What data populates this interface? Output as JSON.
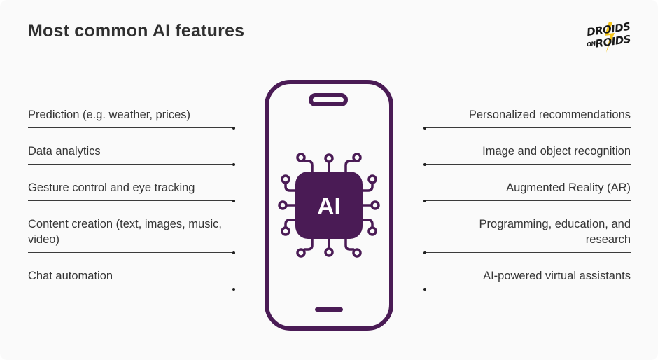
{
  "title": "Most common AI features",
  "logo": {
    "line1": "DROIDS",
    "line2_small": "ON",
    "line2": "ROIDS",
    "bolt_color": "#f5c518"
  },
  "colors": {
    "accent": "#4a1b55",
    "text": "#353535",
    "background": "#fafafa"
  },
  "center_icon": {
    "label": "AI",
    "icon": "smartphone-ai-chip-icon"
  },
  "left_features": [
    {
      "label": "Prediction (e.g. weather, prices)"
    },
    {
      "label": "Data analytics"
    },
    {
      "label": "Gesture control and eye tracking"
    },
    {
      "label": "Content creation (text, images, music, video)"
    },
    {
      "label": "Chat automation"
    }
  ],
  "right_features": [
    {
      "label": "Personalized recommendations"
    },
    {
      "label": "Image and object recognition"
    },
    {
      "label": "Augmented Reality (AR)"
    },
    {
      "label": "Programming, education, and research"
    },
    {
      "label": "AI-powered virtual assistants"
    }
  ]
}
